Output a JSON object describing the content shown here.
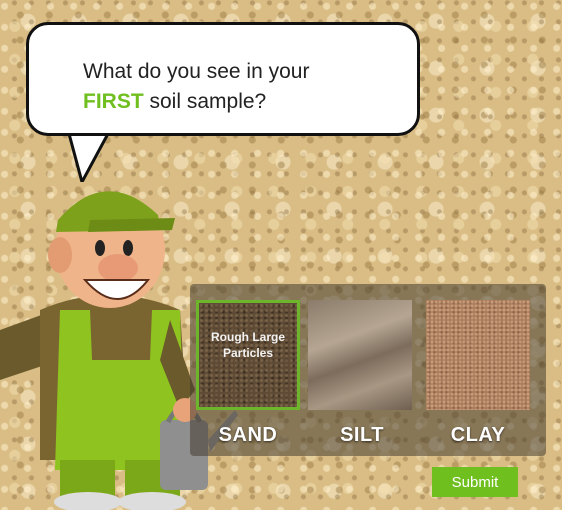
{
  "prompt": {
    "before": "What do you see in your",
    "highlight": "FIRST",
    "after": " soil sample?"
  },
  "options": [
    {
      "label": "SAND",
      "caption": "Rough Large Particles",
      "selected": true
    },
    {
      "label": "SILT",
      "selected": false
    },
    {
      "label": "CLAY",
      "selected": false
    }
  ],
  "submit_label": "Submit",
  "colors": {
    "accent": "#6fbf1f",
    "panel": "#463e32",
    "soil_background": "#d9bd85"
  }
}
